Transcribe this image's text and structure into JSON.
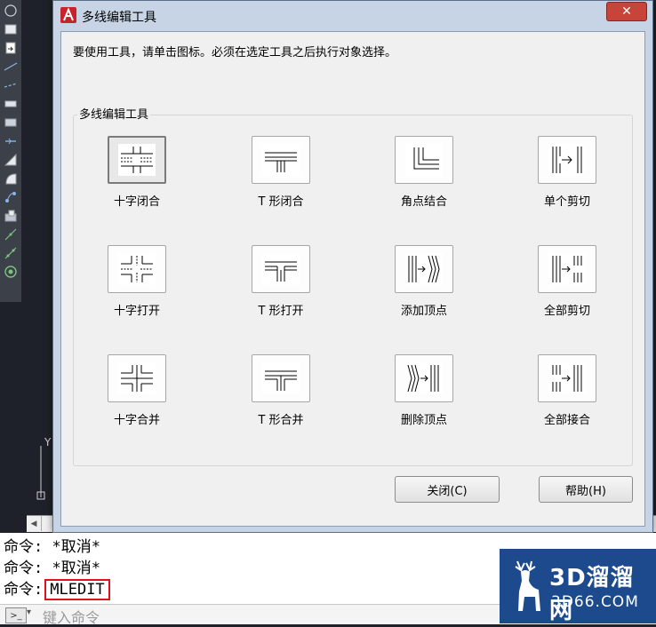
{
  "dialog": {
    "title": "多线编辑工具",
    "close_glyph": "✕",
    "instruction": "要使用工具，请单击图标。必须在选定工具之后执行对象选择。",
    "group_label": "多线编辑工具",
    "tools": [
      {
        "label": "十字闭合",
        "icon": "cross-closed-icon"
      },
      {
        "label": "T 形闭合",
        "icon": "tee-closed-icon"
      },
      {
        "label": "角点结合",
        "icon": "corner-joint-icon"
      },
      {
        "label": "单个剪切",
        "icon": "cut-single-icon"
      },
      {
        "label": "十字打开",
        "icon": "cross-open-icon"
      },
      {
        "label": "T 形打开",
        "icon": "tee-open-icon"
      },
      {
        "label": "添加顶点",
        "icon": "add-vertex-icon"
      },
      {
        "label": "全部剪切",
        "icon": "cut-all-icon"
      },
      {
        "label": "十字合并",
        "icon": "cross-merged-icon"
      },
      {
        "label": "T 形合并",
        "icon": "tee-merged-icon"
      },
      {
        "label": "删除顶点",
        "icon": "delete-vertex-icon"
      },
      {
        "label": "全部接合",
        "icon": "weld-all-icon"
      }
    ],
    "close_button": "关闭(C)",
    "help_button": "帮助(H)"
  },
  "canvas": {
    "ucs_y_label": "Y"
  },
  "command": {
    "history": [
      {
        "prefix": "命令:",
        "text": " *取消*"
      },
      {
        "prefix": "命令:",
        "text": " *取消*"
      },
      {
        "prefix": "命令:",
        "text": "MLEDIT"
      }
    ],
    "input_placeholder": "键入命令"
  },
  "watermark": {
    "brand": "3D溜溜网",
    "domain": "3D66.COM"
  },
  "colors": {
    "highlight": "#e0111b",
    "watermark_bg": "#1c4a8c",
    "canvas_bg": "#1e2129"
  }
}
